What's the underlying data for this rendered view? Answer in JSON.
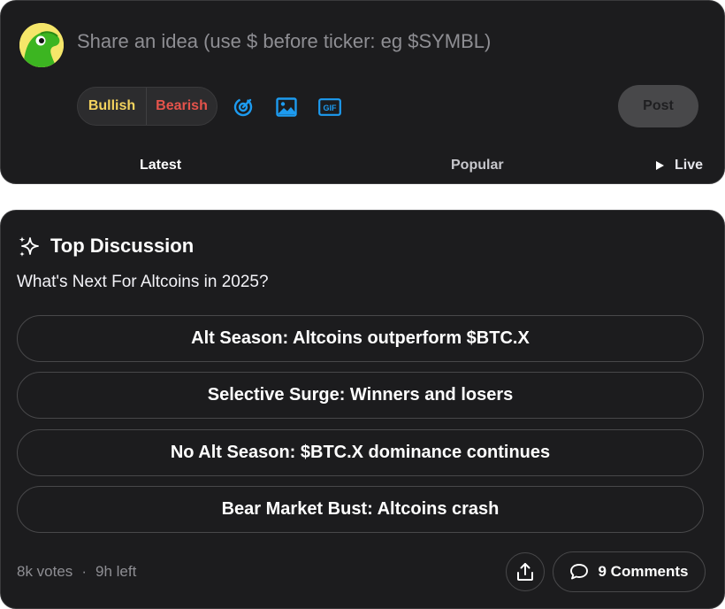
{
  "composer": {
    "placeholder": "Share an idea (use $ before ticker: eg $SYMBL)",
    "bullish_label": "Bullish",
    "bearish_label": "Bearish",
    "gif_label": "GIF",
    "post_label": "Post",
    "icons": [
      "avatar",
      "target-icon",
      "image-icon",
      "gif-icon",
      "play-icon"
    ]
  },
  "tabs": {
    "latest": "Latest",
    "popular": "Popular",
    "live": "Live"
  },
  "discussion": {
    "title": "Top Discussion",
    "question": "What's Next For Altcoins in 2025?",
    "options": [
      "Alt Season: Altcoins outperform $BTC.X",
      "Selective Surge: Winners and losers",
      "No Alt Season: $BTC.X dominance continues",
      "Bear Market Bust: Altcoins crash"
    ],
    "votes": "8k votes",
    "separator": "·",
    "time_left": "9h left",
    "comments_label": "9 Comments"
  },
  "colors": {
    "card_bg": "#1c1c1e",
    "bullish": "#f4d35e",
    "bearish": "#e5534b",
    "accent_blue": "#1d9bf0",
    "avatar_bg": "#f5e66a",
    "avatar_green": "#3cb521"
  }
}
